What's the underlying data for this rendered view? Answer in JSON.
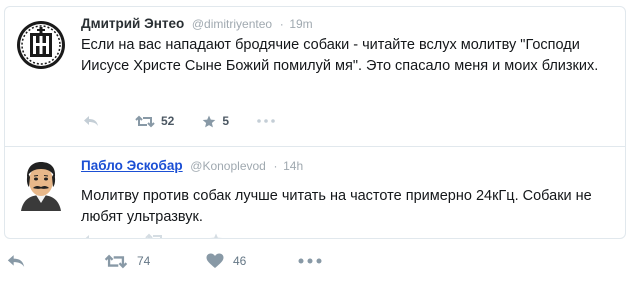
{
  "tweets": [
    {
      "name": "Дмитрий Энтео",
      "handle": "@dimitriyenteo",
      "time": "19m",
      "text": "Если на вас нападают бродячие собаки - читайте вслух молитву \"Господи Иисусе Христе Сыне Божий помилуй мя\". Это спасало меня и моих близких.",
      "retweets": "52",
      "favorites": "5",
      "avatar_icon": "orthodox-seal-icon"
    },
    {
      "name": "Пабло Эскобар",
      "handle": "@Konoplevod",
      "time": "14h",
      "text": "Молитву против собак лучше читать на частоте примерно 24кГц. Собаки не любят ультразвук.",
      "avatar_icon": "mustached-man-cartoon-icon"
    }
  ],
  "footer": {
    "retweets": "74",
    "likes": "46"
  },
  "colors": {
    "link_name": "#1b4fd4",
    "muted": "#8899a6",
    "border": "#e1e8ed"
  }
}
